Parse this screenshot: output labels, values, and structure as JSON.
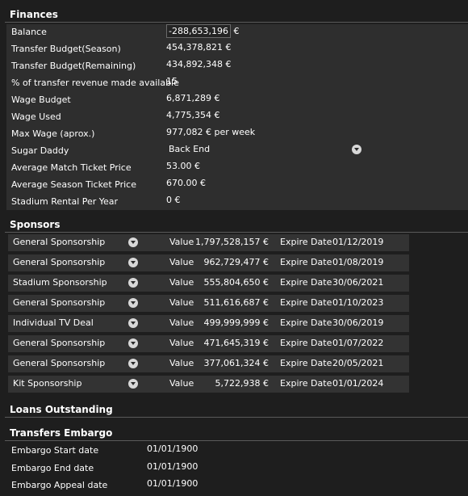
{
  "finances": {
    "title": "Finances",
    "rows": [
      {
        "label": "Balance",
        "value": "-288,653,196",
        "suffix": "€"
      },
      {
        "label": "Transfer Budget(Season)",
        "value": "454,378,821 €"
      },
      {
        "label": "Transfer Budget(Remaining)",
        "value": "434,892,348 €"
      },
      {
        "label": "% of transfer revenue made available",
        "value": "15"
      },
      {
        "label": "Wage Budget",
        "value": "6,871,289 €"
      },
      {
        "label": "Wage Used",
        "value": "4,775,354 €"
      },
      {
        "label": "Max Wage (aprox.)",
        "value": "977,082 € per week"
      },
      {
        "label": "Sugar Daddy",
        "value": "Back End"
      },
      {
        "label": "Average Match Ticket Price",
        "value": "53.00 €"
      },
      {
        "label": "Average Season Ticket Price",
        "value": "670.00 €"
      },
      {
        "label": "Stadium Rental Per Year",
        "value": "0 €"
      }
    ]
  },
  "sponsors": {
    "title": "Sponsors",
    "value_label": "Value",
    "expire_label": "Expire Date",
    "items": [
      {
        "type": "General Sponsorship",
        "value": "1,797,528,157 €",
        "expire": "01/12/2019"
      },
      {
        "type": "General Sponsorship",
        "value": "962,729,477 €",
        "expire": "01/08/2019"
      },
      {
        "type": "Stadium Sponsorship",
        "value": "555,804,650 €",
        "expire": "30/06/2021"
      },
      {
        "type": "General Sponsorship",
        "value": "511,616,687 €",
        "expire": "01/10/2023"
      },
      {
        "type": "Individual TV Deal",
        "value": "499,999,999 €",
        "expire": "30/06/2019"
      },
      {
        "type": "General Sponsorship",
        "value": "471,645,319 €",
        "expire": "01/07/2022"
      },
      {
        "type": "General Sponsorship",
        "value": "377,061,324 €",
        "expire": "20/05/2021"
      },
      {
        "type": "Kit Sponsorship",
        "value": "5,722,938 €",
        "expire": "01/01/2024"
      }
    ]
  },
  "loans": {
    "title": "Loans Outstanding"
  },
  "embargo": {
    "title": "Transfers Embargo",
    "rows": [
      {
        "label": "Embargo Start date",
        "value": "01/01/1900"
      },
      {
        "label": "Embargo End date",
        "value": "01/01/1900"
      },
      {
        "label": "Embargo Appeal date",
        "value": "01/01/1900"
      }
    ]
  }
}
